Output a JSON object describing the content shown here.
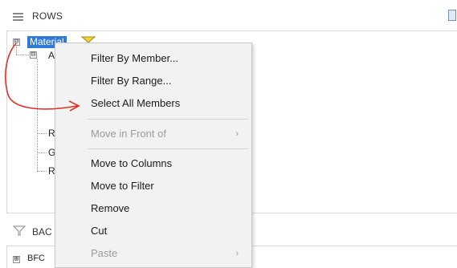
{
  "header": {
    "rows_label": "ROWS",
    "menu_icon": "hamburger-icon",
    "corner_icon": "panel-icon"
  },
  "tree": {
    "root_label": "Material",
    "root_expander": "⊟",
    "root_filter_icon": "filter-funnel-icon",
    "child_expander": "⊟",
    "child_label": "A",
    "leaves": [
      "R",
      "G",
      "R"
    ]
  },
  "context_menu": {
    "items": [
      {
        "label": "Filter By Member...",
        "enabled": true
      },
      {
        "label": "Filter By Range...",
        "enabled": true
      },
      {
        "label": "Select All Members",
        "enabled": true
      },
      {
        "label": "Move in Front of",
        "enabled": false,
        "submenu": "›"
      },
      {
        "label": "Move to Columns",
        "enabled": true
      },
      {
        "label": "Move to Filter",
        "enabled": true
      },
      {
        "label": "Remove",
        "enabled": true
      },
      {
        "label": "Cut",
        "enabled": true
      },
      {
        "label": "Paste",
        "enabled": false,
        "submenu": "›"
      }
    ]
  },
  "background": {
    "label": "BAC",
    "icon": "filter-funnel-icon",
    "item_expander": "⊞",
    "item_label": "BFC"
  },
  "colors": {
    "selection": "#2f7ad6",
    "annotation_arrow": "#e0302a",
    "filter_icon_fill": "#f2d23a"
  }
}
